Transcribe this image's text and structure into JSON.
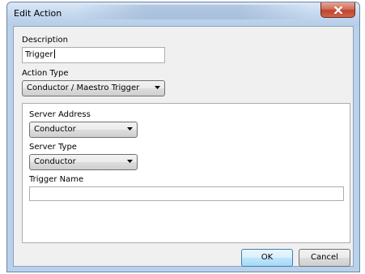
{
  "window": {
    "title": "Edit Action"
  },
  "description": {
    "label": "Description",
    "value": "Trigger"
  },
  "action_type": {
    "label": "Action Type",
    "selected": "Conductor / Maestro Trigger"
  },
  "server_address": {
    "label": "Server Address",
    "selected": "Conductor"
  },
  "server_type": {
    "label": "Server Type",
    "selected": "Conductor"
  },
  "trigger_name": {
    "label": "Trigger Name",
    "value": ""
  },
  "buttons": {
    "ok": "OK",
    "cancel": "Cancel"
  },
  "icons": {
    "close": "close-icon",
    "dropdown": "chevron-down-icon"
  }
}
